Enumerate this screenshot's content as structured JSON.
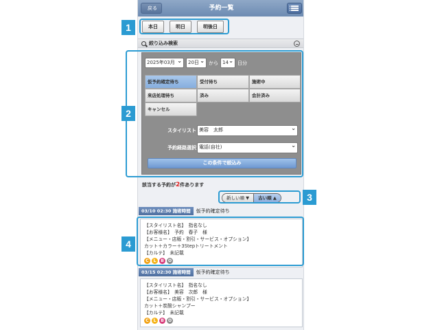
{
  "header": {
    "back_label": "戻る",
    "title": "予約一覧"
  },
  "day_buttons": [
    "本日",
    "明日",
    "明後日"
  ],
  "search": {
    "label": "絞り込み検索"
  },
  "filter": {
    "year_month": "2025年03月",
    "day": "20日",
    "from_text": "から",
    "duration": "14",
    "duration_unit": "日分",
    "statuses": [
      "仮予約確定待ち",
      "受付待ち",
      "施術中",
      "来店処理待ち",
      "済み",
      "会計済み",
      "キャンセル"
    ],
    "stylist_label": "スタイリスト",
    "stylist_value": "美容　太郎",
    "route_label": "予約経路選択",
    "route_value": "電話(自社)",
    "submit_label": "この条件で絞込み"
  },
  "result_count": {
    "prefix": "該当する予約が",
    "count": "2",
    "suffix": "件あります"
  },
  "sort": {
    "newest": "新しい順 ▼",
    "oldest": "古い順 ▲"
  },
  "reservations": [
    {
      "time": "03/10 02:30 施術時間",
      "status": "仮予約確定待ち",
      "lines": [
        "【スタイリスト名】　指名なし",
        "【お客様名】　予約　春子　様",
        "【メニュー・店販・割引・サービス・オプション】",
        "カット＋カラー＋3Stepトリートメント",
        "【カルテ】　未記載"
      ]
    },
    {
      "time": "03/15 02:30 施術時間",
      "status": "仮予約確定待ち",
      "lines": [
        "【スタイリスト名】　指名なし",
        "【お客様名】　美容　次郎　様",
        "【メニュー・店販・割引・サービス・オプション】",
        "カット＋炭酸シャンプー",
        "【カルテ】　未記載"
      ]
    }
  ],
  "status_icons": [
    "C",
    "L",
    "B",
    "O"
  ],
  "callouts": [
    "1",
    "2",
    "3",
    "4"
  ]
}
